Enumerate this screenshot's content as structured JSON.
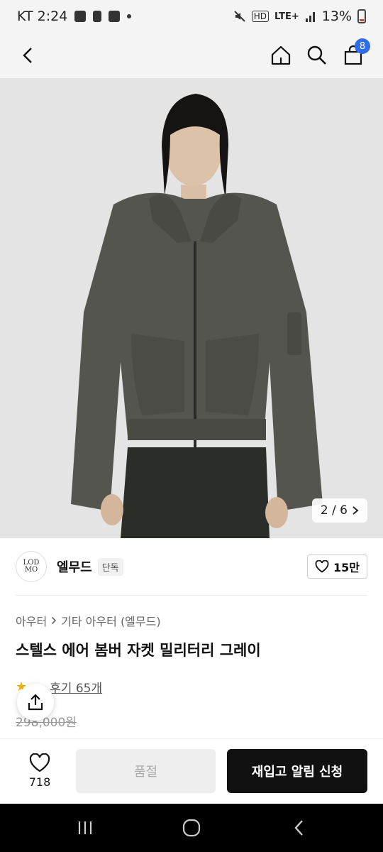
{
  "status_bar": {
    "carrier_time": "KT 2:24",
    "network": "LTE+",
    "hd": "HD",
    "battery": "13%"
  },
  "header": {
    "cart_count": "8"
  },
  "gallery": {
    "counter": "2 / 6"
  },
  "brand": {
    "logo_text": "LOD MO",
    "name": "엘무드",
    "badge": "단독",
    "like_count": "15만"
  },
  "breadcrumb": {
    "items": [
      "아우터",
      "기타 아우터 (엘무드)"
    ]
  },
  "product": {
    "title": "스텔스 에어 봄버 자켓 밀리터리 그레이",
    "review_label": "후기 65개",
    "original_price": "298,000원",
    "sale_price": " "
  },
  "bottom_bar": {
    "wish_count": "718",
    "soldout_label": "품절",
    "restock_label": "재입고 알림 신청"
  },
  "colors": {
    "accent_badge": "#2f6ee6",
    "primary_button": "#111111",
    "disabled_button": "#eeeeee",
    "star": "#f0b400"
  }
}
